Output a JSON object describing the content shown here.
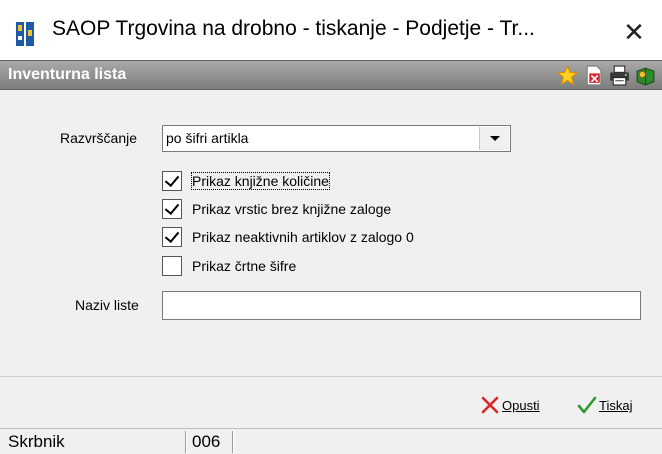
{
  "window": {
    "title": "SAOP Trgovina na drobno - tiskanje - Podjetje - Tr...",
    "close_glyph": "✕"
  },
  "form": {
    "title": "Inventurna lista",
    "header_icons": [
      "star-icon",
      "pdf-export-icon",
      "print-icon",
      "help-book-icon"
    ]
  },
  "sort": {
    "label": "Razvrščanje",
    "value": "po šifri artikla"
  },
  "options": [
    {
      "label": "Prikaz knjižne količine",
      "checked": true
    },
    {
      "label": "Prikaz vrstic brez knjižne zaloge",
      "checked": true
    },
    {
      "label": "Prikaz neaktivnih artiklov z zalogo 0",
      "checked": true
    },
    {
      "label": "Prikaz črtne šifre",
      "checked": false
    }
  ],
  "list_name": {
    "label": "Naziv liste",
    "value": ""
  },
  "buttons": {
    "cancel": "Opusti",
    "print": "Tiskaj"
  },
  "status": {
    "user": "Skrbnik",
    "code": "006"
  },
  "colors": {
    "header_bar": "#8f8f8f",
    "cancel_icon": "#d9262b",
    "print_icon": "#2e9a2e"
  }
}
